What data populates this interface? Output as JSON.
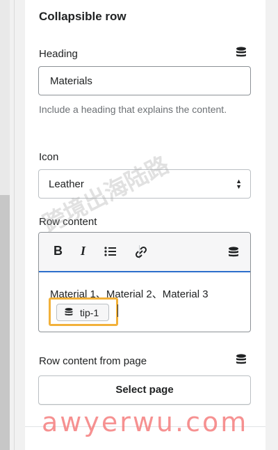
{
  "section": {
    "title": "Collapsible row"
  },
  "heading": {
    "label": "Heading",
    "value": "Materials",
    "help": "Include a heading that explains the content."
  },
  "icon": {
    "label": "Icon",
    "value": "Leather"
  },
  "row_content": {
    "label": "Row content",
    "toolbar": {
      "bold": "B",
      "italic": "I"
    },
    "text": "Material 1、Material 2、Material 3",
    "tip_label": "tip-1"
  },
  "row_content_page": {
    "label": "Row content from page",
    "button": "Select page"
  },
  "watermark": {
    "cn": "跨境出海陆路",
    "url": "awyerwu.com"
  },
  "colors": {
    "accent": "#2c6ecb",
    "highlight": "#f2b13a",
    "watermark": "#f47575"
  },
  "icons": [
    "database-icon",
    "bold-icon",
    "italic-icon",
    "list-icon",
    "link-icon",
    "select-arrows-icon"
  ]
}
